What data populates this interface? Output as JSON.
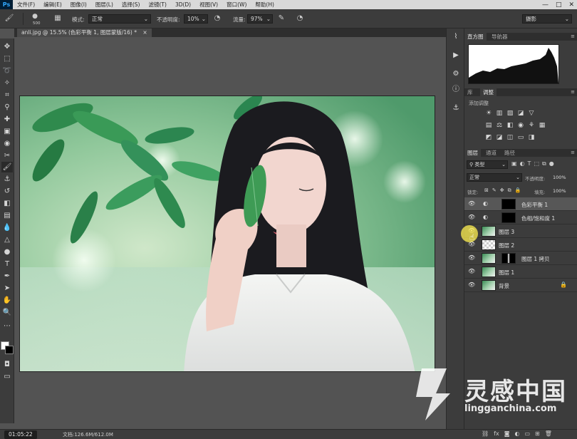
{
  "app": {
    "logo": "Ps"
  },
  "menu": [
    "文件(F)",
    "编辑(E)",
    "图像(I)",
    "图层(L)",
    "选择(S)",
    "滤镜(T)",
    "3D(D)",
    "视图(V)",
    "窗口(W)",
    "帮助(H)"
  ],
  "window_controls": [
    "—",
    "□",
    "✕"
  ],
  "options": {
    "brush_size": "500",
    "mode_label": "模式:",
    "mode_value": "正常",
    "opacity_label": "不透明度:",
    "opacity_value": "10%",
    "flow_label": "流量:",
    "flow_value": "97%",
    "workspace_value": "摄影"
  },
  "document": {
    "tab_title": "anli.jpg @ 15.5% (色彩平衡 1, 图层蒙版/16) *",
    "close": "×"
  },
  "histogram_tabs": [
    "直方图",
    "导航器"
  ],
  "adjust_tabs": [
    "库",
    "调整"
  ],
  "adjust_hint": "添加调整",
  "layers_tabs": [
    "图层",
    "通道",
    "路径"
  ],
  "layers_panel": {
    "filter_kind": "类型",
    "blend_mode": "正常",
    "opacity_label": "不透明度:",
    "opacity_value": "100%",
    "lock_label": "锁定:",
    "fill_label": "填充:",
    "fill_value": "100%"
  },
  "layers": [
    {
      "name": "色彩平衡 1",
      "type": "adjustment",
      "selected": true
    },
    {
      "name": "色相/饱和度 1",
      "type": "adjustment",
      "selected": false
    },
    {
      "name": "图层 3",
      "type": "image",
      "selected": false
    },
    {
      "name": "图层 2",
      "type": "transparent",
      "selected": false
    },
    {
      "name": "图层 1 拷贝",
      "type": "image-mask",
      "selected": false
    },
    {
      "name": "图层 1",
      "type": "image",
      "selected": false
    },
    {
      "name": "背景",
      "type": "background",
      "selected": false
    }
  ],
  "status": {
    "timer": "01:05:22",
    "doc_info": "文档:126.6M/612.0M"
  },
  "watermark": {
    "cn": "灵感中国",
    "en": "lingganchina.com"
  },
  "colors": {
    "accent": "#31a8ff",
    "panel": "#3c3c3c",
    "canvas": "#535353"
  }
}
